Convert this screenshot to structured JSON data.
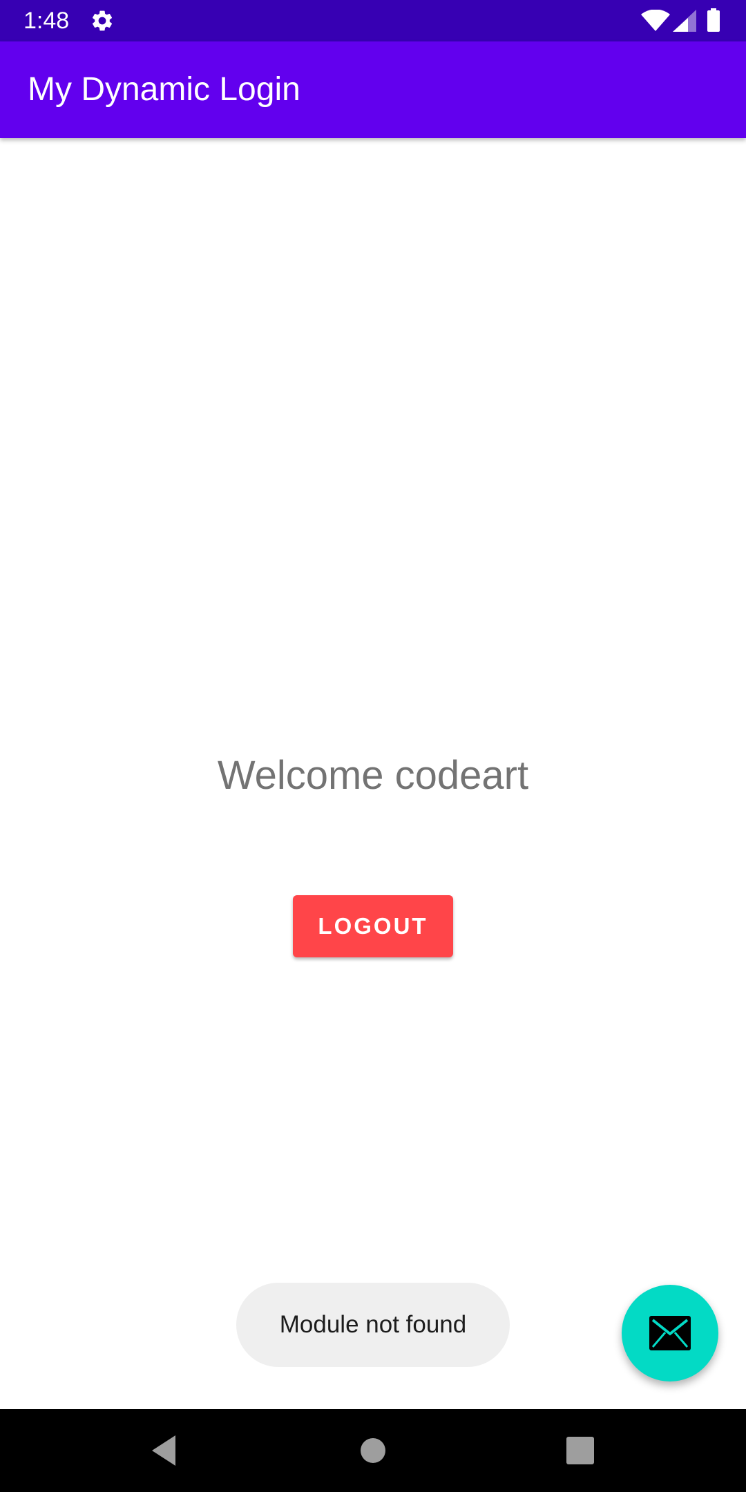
{
  "status_bar": {
    "time": "1:48",
    "icons": [
      "gear-icon",
      "wifi-icon",
      "signal-icon",
      "battery-icon"
    ],
    "background": "#3700B3"
  },
  "app_bar": {
    "title": "My Dynamic Login",
    "background": "#6200EE"
  },
  "main": {
    "welcome_text": "Welcome codeart",
    "logout_label": "LOGOUT",
    "logout_color": "#FF4549"
  },
  "toast": {
    "message": "Module not found"
  },
  "fab": {
    "icon": "mail-icon",
    "color": "#03DAC5"
  },
  "nav_bar": {
    "icons": [
      "back-icon",
      "home-icon",
      "recents-icon"
    ]
  }
}
